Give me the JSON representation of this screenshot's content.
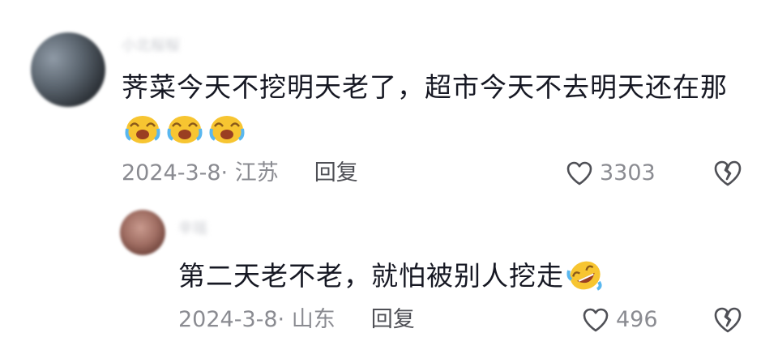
{
  "comments": [
    {
      "username": "小北桜桜",
      "text": "荠菜今天不挖明天老了，超市今天不去明天还在那",
      "emojis": [
        "laugh-cry-emoji",
        "laugh-cry-emoji",
        "laugh-cry-emoji"
      ],
      "date": "2024-3-8· 江苏",
      "reply_label": "回复",
      "likes": "3303"
    },
    {
      "username": "辛瑶",
      "text": "第二天老不老，就怕被别人挖走",
      "emojis": [
        "rolling-laugh-emoji"
      ],
      "date": "2024-3-8· 山东",
      "reply_label": "回复",
      "likes": "496"
    }
  ],
  "icons": {
    "like": "heart-outline-icon",
    "dislike": "broken-heart-icon"
  },
  "colors": {
    "text": "#161823",
    "meta": "#8a8b91",
    "emoji_face": "#f7c531"
  }
}
